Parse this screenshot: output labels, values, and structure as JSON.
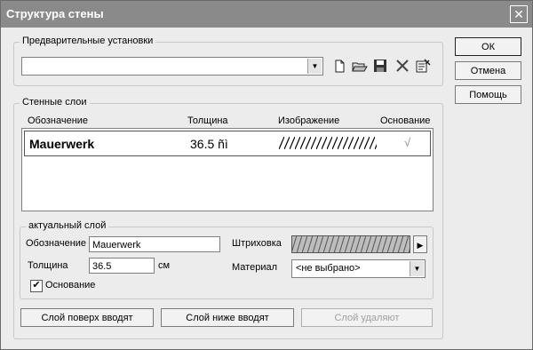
{
  "window": {
    "title": "Структура стены",
    "close_glyph": "✕"
  },
  "presets": {
    "group_label": "Предварительные установки",
    "combo_value": "",
    "icons": [
      "new-file-icon",
      "open-folder-icon",
      "save-disk-icon",
      "delete-x-icon",
      "properties-icon"
    ]
  },
  "side_buttons": {
    "ok": "ОК",
    "cancel": "Отмена",
    "help": "Помощь"
  },
  "layers": {
    "group_label": "Стенные слои",
    "columns": [
      "Обозначение",
      "Толщина",
      "Изображение",
      "Основание"
    ],
    "rows": [
      {
        "name": "Mauerwerk",
        "thickness": "36.5 ñì",
        "base_mark": "√"
      }
    ]
  },
  "current": {
    "group_label": "актуальный слой",
    "name_label": "Обозначение",
    "name_value": "Mauerwerk",
    "thickness_label": "Толщина",
    "thickness_value": "36.5",
    "unit": "см",
    "hatch_label": "Штриховка",
    "hatch_arrow": "▶",
    "material_label": "Материал",
    "material_value": "<не выбрано>",
    "base_label": "Основание",
    "base_checked": "✔"
  },
  "actions": {
    "add_above": "Слой поверх вводят",
    "add_below": "Слой ниже вводят",
    "delete": "Слой удаляют"
  }
}
